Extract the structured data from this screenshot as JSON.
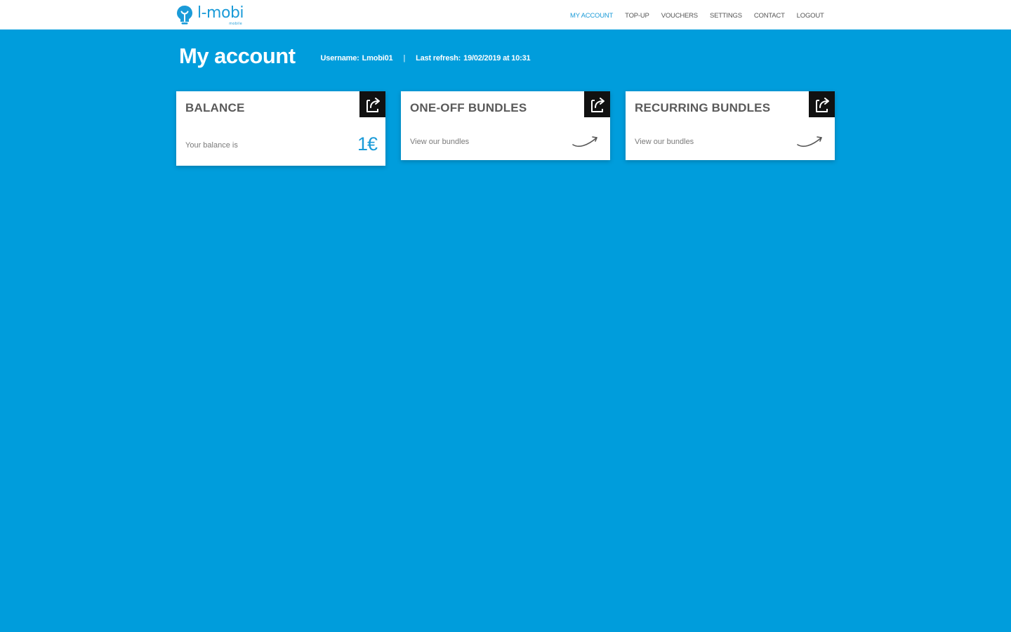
{
  "brand": {
    "name": "l-mobi",
    "tagline": "mobile"
  },
  "nav": {
    "items": [
      {
        "label": "MY ACCOUNT",
        "active": true
      },
      {
        "label": "TOP-UP",
        "active": false
      },
      {
        "label": "VOUCHERS",
        "active": false
      },
      {
        "label": "SETTINGS",
        "active": false
      },
      {
        "label": "CONTACT",
        "active": false
      },
      {
        "label": "LOGOUT",
        "active": false
      }
    ]
  },
  "page": {
    "title": "My account",
    "username_label": "Username:",
    "username": "Lmobi01",
    "separator": "|",
    "refresh_label": "Last refresh:",
    "refresh_value": "19/02/2019 at 10:31"
  },
  "cards": {
    "balance": {
      "title": "BALANCE",
      "subtitle": "Your balance is",
      "value": "1€",
      "icon": "open-external-icon"
    },
    "one_off": {
      "title": "ONE-OFF BUNDLES",
      "subtitle": "View our bundles",
      "icon": "open-external-icon",
      "arrow_icon": "curved-arrow-icon"
    },
    "recurring": {
      "title": "RECURRING BUNDLES",
      "subtitle": "View our bundles",
      "icon": "open-external-icon",
      "arrow_icon": "curved-arrow-icon"
    }
  },
  "colors": {
    "background": "#009ddc",
    "accent": "#1b9bd8",
    "topbar": "#ffffff",
    "icon_box": "#111111"
  }
}
